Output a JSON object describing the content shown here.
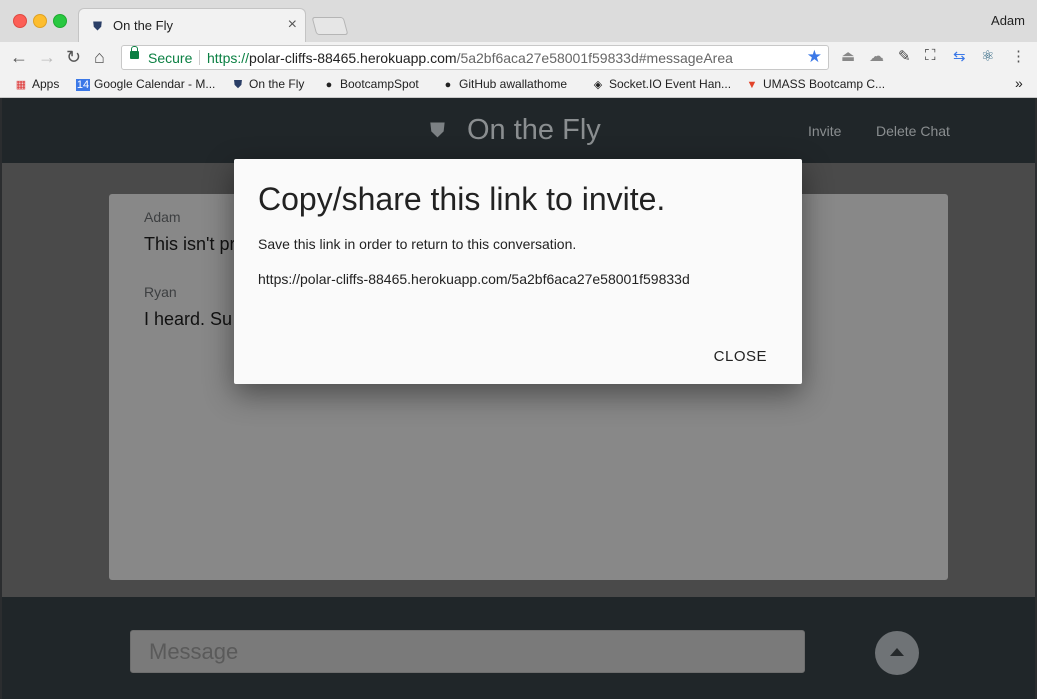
{
  "browser": {
    "tab_title": "On the Fly",
    "tab_close": "×",
    "profile_name": "Adam",
    "secure_label": "Secure",
    "url_scheme": "https://",
    "url_host": "polar-cliffs-88465.herokuapp.com",
    "url_path": "/5a2bf6aca27e58001f59833d#messageArea",
    "bookmarks": [
      {
        "label": "Apps",
        "icon": "apps-grid-icon"
      },
      {
        "label": "Google Calendar - M...",
        "icon": "calendar-icon"
      },
      {
        "label": "On the Fly",
        "icon": "shield-icon"
      },
      {
        "label": "BootcampSpot",
        "icon": "github-icon"
      },
      {
        "label": "GitHub awallathome",
        "icon": "github-icon"
      },
      {
        "label": "Socket.IO Event Han...",
        "icon": "socketio-icon"
      },
      {
        "label": "UMASS Bootcamp C...",
        "icon": "gitlab-icon"
      }
    ],
    "more_bookmarks": "»"
  },
  "app": {
    "brand": "On the Fly",
    "nav": {
      "invite": "Invite",
      "delete_chat": "Delete Chat"
    },
    "messages": [
      {
        "sender": "Adam",
        "text": "This isn't pr"
      },
      {
        "sender": "Ryan",
        "text": "I heard. Su"
      }
    ],
    "message_placeholder": "Message"
  },
  "modal": {
    "title": "Copy/share this link to invite.",
    "subtitle": "Save this link in order to return to this conversation.",
    "link": "https://polar-cliffs-88465.herokuapp.com/5a2bf6aca27e58001f59833d",
    "close_label": "CLOSE"
  }
}
